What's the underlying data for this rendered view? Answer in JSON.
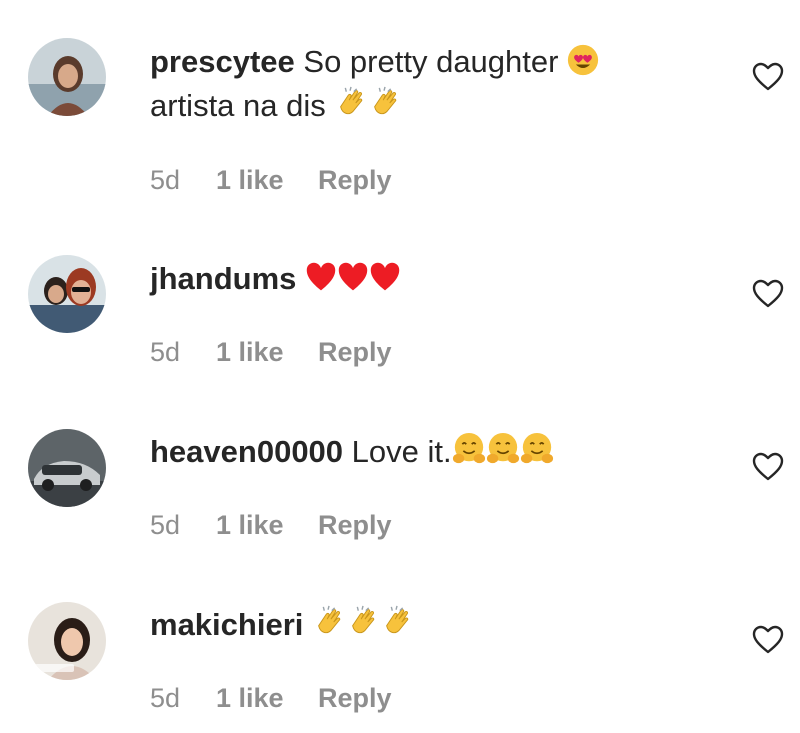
{
  "comments": [
    {
      "username": "prescytee",
      "text_line1": "So pretty daughter",
      "text_line2": "artista na dis",
      "age": "5d",
      "likes": "1 like",
      "reply": "Reply"
    },
    {
      "username": "jhandums",
      "text_line1": "",
      "age": "5d",
      "likes": "1 like",
      "reply": "Reply"
    },
    {
      "username": "heaven00000",
      "text_line1": "Love it.",
      "age": "5d",
      "likes": "1 like",
      "reply": "Reply"
    },
    {
      "username": "makichieri",
      "text_line1": "",
      "age": "5d",
      "likes": "1 like",
      "reply": "Reply"
    }
  ],
  "icons": {
    "like": "heart-outline-icon",
    "emoji_heart_eyes": "heart-eyes-emoji",
    "emoji_clap": "clapping-hands-emoji",
    "emoji_red_heart": "red-heart-emoji",
    "emoji_hug": "hugging-face-emoji"
  },
  "colors": {
    "text": "#262626",
    "secondary_text": "#8e8e8e",
    "heart_red": "#ed1c24",
    "emoji_yellow": "#f7c23c"
  }
}
